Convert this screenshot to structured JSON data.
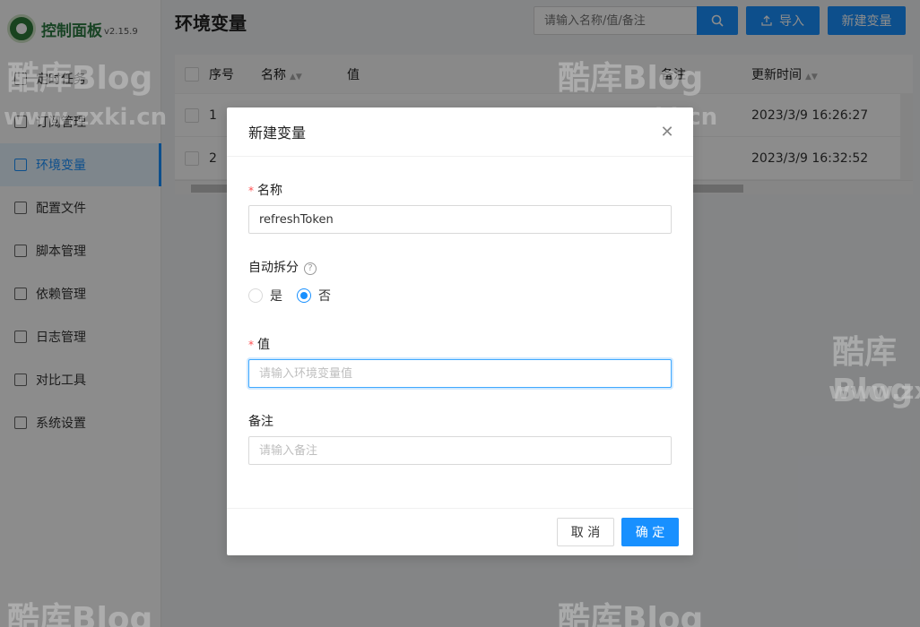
{
  "app": {
    "title": "控制面板",
    "version": "v2.15.9"
  },
  "sidebar": {
    "items": [
      {
        "label": "定时任务",
        "icon": "schedule-icon",
        "active": false
      },
      {
        "label": "订阅管理",
        "icon": "subscription-icon",
        "active": false
      },
      {
        "label": "环境变量",
        "icon": "env-icon",
        "active": true
      },
      {
        "label": "配置文件",
        "icon": "sliders-icon",
        "active": false
      },
      {
        "label": "脚本管理",
        "icon": "script-icon",
        "active": false
      },
      {
        "label": "依赖管理",
        "icon": "dependency-icon",
        "active": false
      },
      {
        "label": "日志管理",
        "icon": "log-icon",
        "active": false
      },
      {
        "label": "对比工具",
        "icon": "compare-icon",
        "active": false
      },
      {
        "label": "系统设置",
        "icon": "gear-icon",
        "active": false
      }
    ]
  },
  "header": {
    "title": "环境变量",
    "search_placeholder": "请输入名称/值/备注",
    "import_label": "导入",
    "new_label": "新建变量"
  },
  "table": {
    "columns": [
      "序号",
      "名称",
      "值",
      "备注",
      "更新时间"
    ],
    "rows": [
      {
        "index": "1",
        "updated": "2023/3/9 16:26:27"
      },
      {
        "index": "2",
        "updated": "2023/3/9 16:32:52"
      }
    ]
  },
  "modal": {
    "title": "新建变量",
    "name_label": "名称",
    "name_value": "refreshToken",
    "split_label": "自动拆分",
    "radio_yes": "是",
    "radio_no": "否",
    "value_label": "值",
    "value_placeholder": "请输入环境变量值",
    "remark_label": "备注",
    "remark_placeholder": "请输入备注",
    "cancel_label": "取 消",
    "ok_label": "确 定"
  },
  "watermark": {
    "brand": "酷库Blog",
    "domain": "www.zxki.cn"
  },
  "colors": {
    "primary": "#1890ff",
    "required": "#ff4d4f",
    "logo": "#2c7a43"
  }
}
